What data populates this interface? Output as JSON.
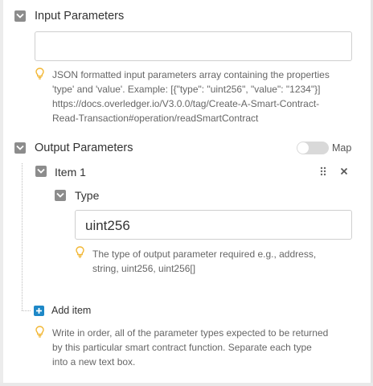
{
  "input_parameters": {
    "title": "Input Parameters",
    "value": "",
    "hint": "JSON formatted input parameters array containing the properties 'type' and 'value'. Example: [{\"type\": \"uint256\", \"value\": \"1234\"}] https://docs.overledger.io/V3.0.0/tag/Create-A-Smart-Contract-Read-Transaction#operation/readSmartContract",
    "hint_lines": [
      "JSON formatted input parameters array containing the properties",
      "'type' and 'value'. Example: [{\"type\": \"uint256\", \"value\": \"1234\"}]",
      "https://docs.overledger.io/V3.0.0/tag/Create-A-Smart-Contract-",
      "Read-Transaction#operation/readSmartContract"
    ]
  },
  "output_parameters": {
    "title": "Output Parameters",
    "map_label": "Map",
    "map_enabled": false,
    "items": [
      {
        "title": "Item 1",
        "type_label": "Type",
        "type_value": "uint256",
        "type_hint_lines": [
          "The type of output parameter required e.g., address,",
          "string, uint256, uint256[]"
        ]
      }
    ],
    "add_item_label": "Add item",
    "hint_lines": [
      "Write in order, all of the parameter types expected to be returned",
      "by this particular smart contract function. Separate each type",
      "into a new text box."
    ]
  },
  "colors": {
    "checkbox": "#8c8c8c",
    "add_button": "#1e88c7",
    "hint_icon": "#f2b632"
  }
}
